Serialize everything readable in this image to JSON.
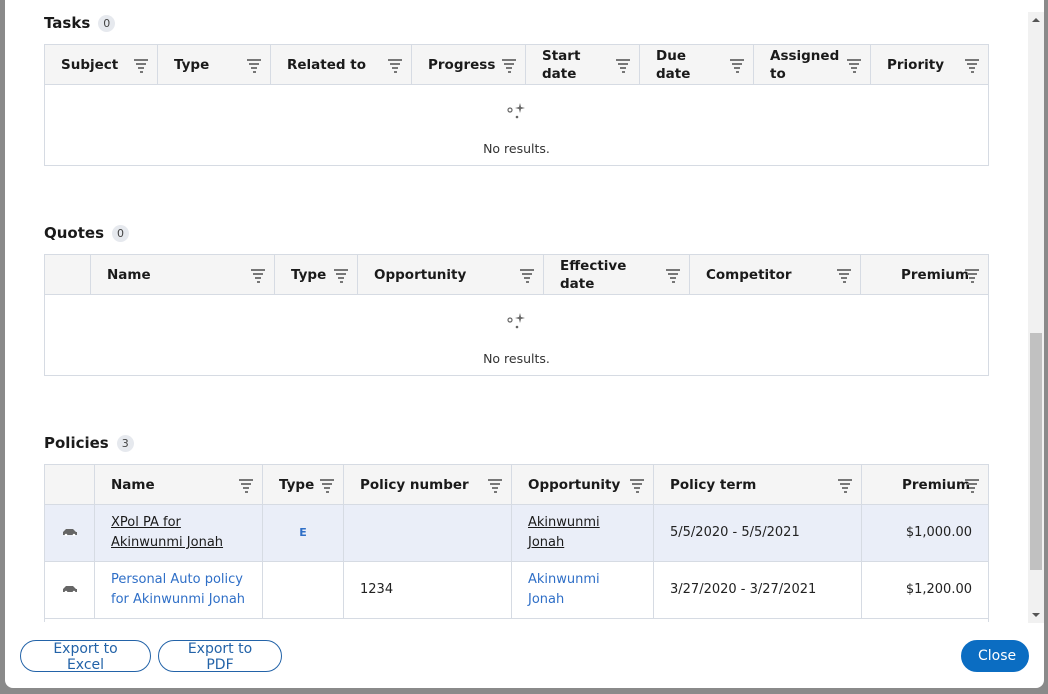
{
  "tasks": {
    "title": "Tasks",
    "count": "0",
    "columns": [
      "Subject",
      "Type",
      "Related to",
      "Progress",
      "Start date",
      "Due date",
      "Assigned to",
      "Priority"
    ],
    "empty": "No results."
  },
  "quotes": {
    "title": "Quotes",
    "count": "0",
    "columns": [
      "",
      "Name",
      "Type",
      "Opportunity",
      "Effective date",
      "Competitor",
      "Premium"
    ],
    "empty": "No results."
  },
  "policies": {
    "title": "Policies",
    "count": "3",
    "columns": [
      "",
      "Name",
      "Type",
      "Policy number",
      "Opportunity",
      "Policy term",
      "Premium"
    ],
    "rows": [
      {
        "icon": "car-icon",
        "name": "XPol PA for Akinwunmi Jonah",
        "type": "E",
        "policy_number": "",
        "opportunity": "Akinwunmi Jonah",
        "term": "5/5/2020 - 5/5/2021",
        "premium": "$1,000.00",
        "selected": true
      },
      {
        "icon": "car-icon",
        "name": "Personal Auto policy for Akinwunmi Jonah",
        "type": "",
        "policy_number": "1234",
        "opportunity": "Akinwunmi Jonah",
        "term": "3/27/2020 - 3/27/2021",
        "premium": "$1,200.00",
        "selected": false
      }
    ]
  },
  "footer": {
    "export_excel": "Export to Excel",
    "export_pdf": "Export to PDF",
    "close": "Close"
  },
  "colors": {
    "accent": "#0b6dc2",
    "link": "#2f6fc7",
    "selected_row": "#eaeef8"
  }
}
